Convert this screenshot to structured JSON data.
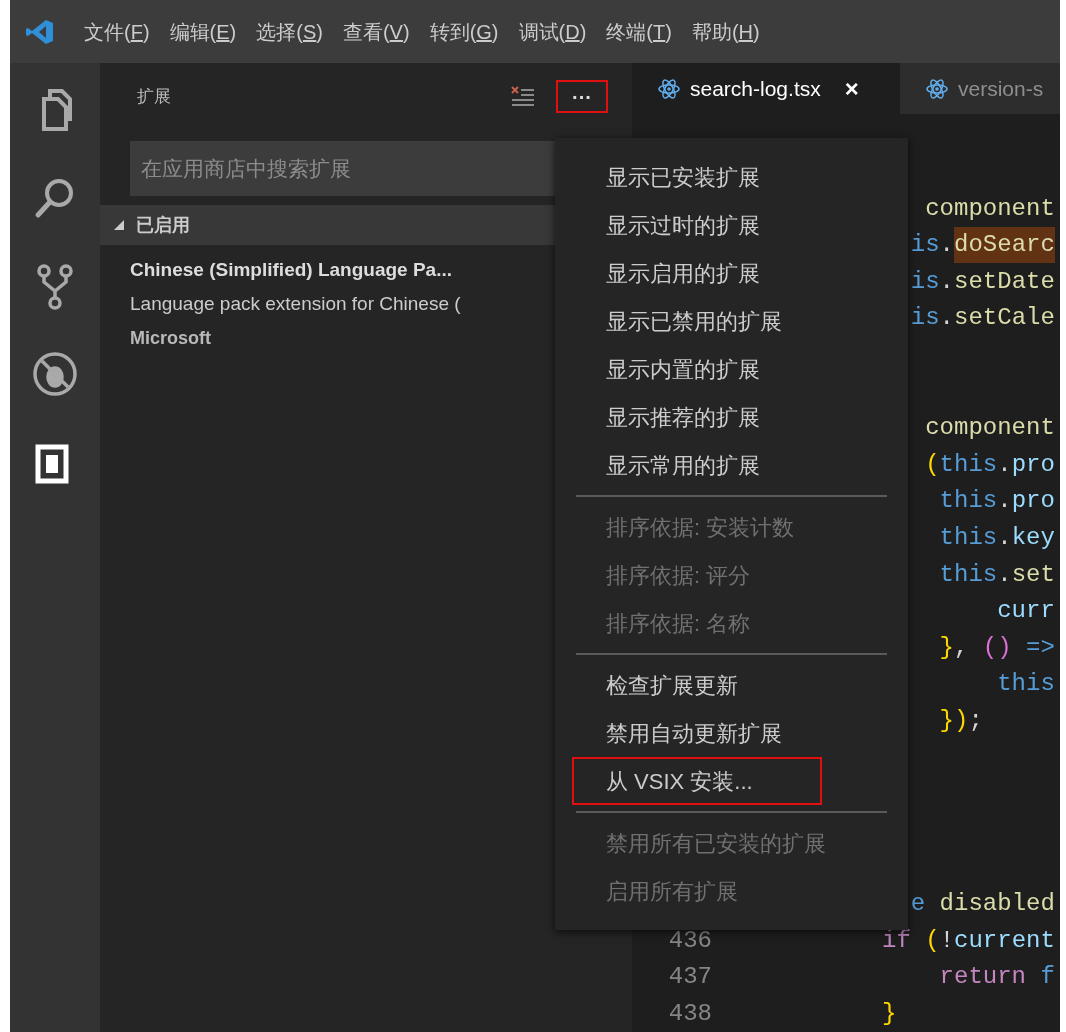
{
  "menubar": [
    {
      "prefix": "文件(",
      "mnemonic": "F",
      "suffix": ")"
    },
    {
      "prefix": "编辑(",
      "mnemonic": "E",
      "suffix": ")"
    },
    {
      "prefix": "选择(",
      "mnemonic": "S",
      "suffix": ")"
    },
    {
      "prefix": "查看(",
      "mnemonic": "V",
      "suffix": ")"
    },
    {
      "prefix": "转到(",
      "mnemonic": "G",
      "suffix": ")"
    },
    {
      "prefix": "调试(",
      "mnemonic": "D",
      "suffix": ")"
    },
    {
      "prefix": "终端(",
      "mnemonic": "T",
      "suffix": ")"
    },
    {
      "prefix": "帮助(",
      "mnemonic": "H",
      "suffix": ")"
    }
  ],
  "activity_bar": [
    {
      "kind": "files",
      "selected": false
    },
    {
      "kind": "search",
      "selected": false
    },
    {
      "kind": "source-control",
      "selected": false
    },
    {
      "kind": "debug",
      "selected": false
    },
    {
      "kind": "extensions",
      "selected": true
    }
  ],
  "sidebar": {
    "title": "扩展",
    "more_button": {
      "label": "···",
      "outlined": true
    },
    "search": {
      "placeholder": "在应用商店中搜索扩展"
    },
    "section": {
      "label": "已启用",
      "expanded": true
    },
    "extensions": [
      {
        "name": "Chinese (Simplified) Language Pa...",
        "description": "Language pack extension for Chinese (",
        "publisher": "Microsoft"
      }
    ]
  },
  "tabs": [
    {
      "label": "search-log.tsx",
      "close": "×",
      "selected": true
    },
    {
      "label": "version-s",
      "selected": false
    }
  ],
  "editor": {
    "lines": [
      {
        "kind": "code",
        "tokens": [
          {
            "text": "   component",
            "color": "#dcdcaa"
          }
        ]
      },
      {
        "kind": "code",
        "tokens": [
          {
            "text": "  is",
            "color": "#569cd6"
          },
          {
            "text": ".",
            "color": "#d4d4d4"
          },
          {
            "text": "doSearc",
            "color": "#dcdcaa",
            "highlighted": true
          }
        ]
      },
      {
        "kind": "code",
        "tokens": [
          {
            "text": "  is",
            "color": "#569cd6"
          },
          {
            "text": ".",
            "color": "#d4d4d4"
          },
          {
            "text": "setDate",
            "color": "#dcdcaa"
          }
        ]
      },
      {
        "kind": "code",
        "tokens": [
          {
            "text": "  is",
            "color": "#569cd6"
          },
          {
            "text": ".",
            "color": "#d4d4d4"
          },
          {
            "text": "setCale",
            "color": "#dcdcaa"
          }
        ]
      },
      {
        "kind": "blank"
      },
      {
        "kind": "blank"
      },
      {
        "kind": "code",
        "tokens": [
          {
            "text": "   component",
            "color": "#dcdcaa"
          }
        ]
      },
      {
        "kind": "code",
        "tokens": [
          {
            "text": "   (",
            "color": "#ffd700"
          },
          {
            "text": "this",
            "color": "#569cd6"
          },
          {
            "text": ".",
            "color": "#d4d4d4"
          },
          {
            "text": "pro",
            "color": "#9cdcfe"
          }
        ]
      },
      {
        "kind": "code",
        "tokens": [
          {
            "text": "    this",
            "color": "#569cd6"
          },
          {
            "text": ".",
            "color": "#d4d4d4"
          },
          {
            "text": "pro",
            "color": "#9cdcfe"
          }
        ]
      },
      {
        "kind": "code",
        "tokens": [
          {
            "text": "    this",
            "color": "#569cd6"
          },
          {
            "text": ".",
            "color": "#d4d4d4"
          },
          {
            "text": "key",
            "color": "#9cdcfe"
          }
        ]
      },
      {
        "kind": "code",
        "tokens": [
          {
            "text": "    this",
            "color": "#569cd6"
          },
          {
            "text": ".",
            "color": "#d4d4d4"
          },
          {
            "text": "set",
            "color": "#dcdcaa"
          }
        ]
      },
      {
        "kind": "code",
        "tokens": [
          {
            "text": "        curr",
            "color": "#9cdcfe"
          }
        ]
      },
      {
        "kind": "code",
        "tokens": [
          {
            "text": "    }",
            "color": "#ffd700"
          },
          {
            "text": ", ",
            "color": "#d4d4d4"
          },
          {
            "text": "()",
            "color": "#da70d6"
          },
          {
            "text": " =>",
            "color": "#569cd6"
          }
        ]
      },
      {
        "kind": "code",
        "tokens": [
          {
            "text": "        this",
            "color": "#569cd6"
          }
        ]
      },
      {
        "kind": "code",
        "tokens": [
          {
            "text": "    })",
            "color": "#ffd700"
          },
          {
            "text": ";",
            "color": "#d4d4d4"
          }
        ]
      },
      {
        "kind": "blank"
      },
      {
        "kind": "blank"
      },
      {
        "kind": "blank"
      },
      {
        "kind": "blank"
      },
      {
        "kind": "code",
        "tokens": [
          {
            "text": "  e",
            "color": "#569cd6"
          },
          {
            "text": " disabled",
            "color": "#dcdcaa"
          }
        ]
      },
      {
        "kind": "code",
        "number": "436",
        "tokens": [
          {
            "text": "if",
            "color": "#c586c0"
          },
          {
            "text": " (",
            "color": "#ffd700"
          },
          {
            "text": "!",
            "color": "#d4d4d4"
          },
          {
            "text": "current",
            "color": "#9cdcfe"
          }
        ]
      },
      {
        "kind": "code",
        "number": "437",
        "tokens": [
          {
            "text": "    return",
            "color": "#c586c0"
          },
          {
            "text": " f",
            "color": "#569cd6"
          }
        ]
      },
      {
        "kind": "code",
        "number": "438",
        "tokens": [
          {
            "text": "}",
            "color": "#ffd700"
          }
        ]
      }
    ]
  },
  "context_menu": {
    "groups": [
      [
        {
          "label": "显示已安装扩展",
          "disabled": false,
          "outlined": false
        },
        {
          "label": "显示过时的扩展",
          "disabled": false,
          "outlined": false
        },
        {
          "label": "显示启用的扩展",
          "disabled": false,
          "outlined": false
        },
        {
          "label": "显示已禁用的扩展",
          "disabled": false,
          "outlined": false
        },
        {
          "label": "显示内置的扩展",
          "disabled": false,
          "outlined": false
        },
        {
          "label": "显示推荐的扩展",
          "disabled": false,
          "outlined": false
        },
        {
          "label": "显示常用的扩展",
          "disabled": false,
          "outlined": false
        }
      ],
      [
        {
          "label": "排序依据: 安装计数",
          "disabled": true,
          "outlined": false
        },
        {
          "label": "排序依据: 评分",
          "disabled": true,
          "outlined": false
        },
        {
          "label": "排序依据: 名称",
          "disabled": true,
          "outlined": false
        }
      ],
      [
        {
          "label": "检查扩展更新",
          "disabled": false,
          "outlined": false
        },
        {
          "label": "禁用自动更新扩展",
          "disabled": false,
          "outlined": false
        },
        {
          "label": "从 VSIX 安装...",
          "disabled": false,
          "outlined": true
        }
      ],
      [
        {
          "label": "禁用所有已安装的扩展",
          "disabled": true,
          "outlined": false
        },
        {
          "label": "启用所有扩展",
          "disabled": true,
          "outlined": false
        }
      ]
    ]
  }
}
